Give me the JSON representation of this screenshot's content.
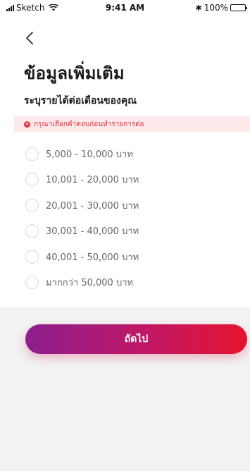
{
  "status_bar": {
    "carrier": "Sketch",
    "time": "9:41 AM",
    "battery": "100%",
    "bluetooth": "✱"
  },
  "header": {
    "back_icon": "chevron-left-icon",
    "title": "ข้อมูลเพิ่มเติม"
  },
  "question": "ระบุรายได้ต่อเดือนของคุณ",
  "error": {
    "message": "กรุณาเลือกคำตอบก่อนทำรายการต่อ",
    "icon": "x-icon",
    "color": "#e0303f"
  },
  "options": [
    {
      "label": "5,000 - 10,000 บาท"
    },
    {
      "label": "10,001 - 20,000 บาท"
    },
    {
      "label": "20,001 - 30,000 บาท"
    },
    {
      "label": "30,001 - 40,000 บาท"
    },
    {
      "label": "40,001 - 50,000 บาท"
    },
    {
      "label": "มากกว่า 50,000 บาท"
    }
  ],
  "next_button": {
    "label": "ถัดไป",
    "gradient_start": "#8c1f8f",
    "gradient_end": "#e5142f"
  }
}
